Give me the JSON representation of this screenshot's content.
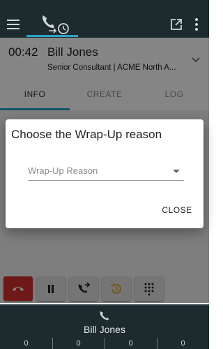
{
  "topbar": {
    "menu_icon": "hamburger-menu-icon",
    "call_tab_icon": "phone-history-icon",
    "popout_icon": "open-in-new-icon",
    "more_icon": "more-vert-icon"
  },
  "call": {
    "timer": "00:42",
    "name": "Bill Jones",
    "subtitle": "Senior Consultant | ACME North A..."
  },
  "tabs": [
    {
      "label": "INFO",
      "active": true
    },
    {
      "label": "CREATE",
      "active": false
    },
    {
      "label": "LOG",
      "active": false
    }
  ],
  "dialog": {
    "title": "Choose the Wrap-Up reason",
    "select_placeholder": "Wrap-Up Reason",
    "close_label": "CLOSE"
  },
  "controls": [
    {
      "name": "hangup-icon",
      "color": "#d32f2f"
    },
    {
      "name": "pause-icon"
    },
    {
      "name": "transfer-call-icon"
    },
    {
      "name": "wrap-up-history-icon",
      "color": "#e0a020"
    },
    {
      "name": "dialpad-icon"
    }
  ],
  "bottombar": {
    "phone_icon": "phone-icon",
    "name": "Bill Jones",
    "counters": [
      "0",
      "0",
      "0",
      "0"
    ]
  },
  "colors": {
    "bar": "#1e2b2e",
    "accent": "#2aa4c6",
    "hangup": "#d32f2f",
    "wrapup": "#e0a020"
  }
}
